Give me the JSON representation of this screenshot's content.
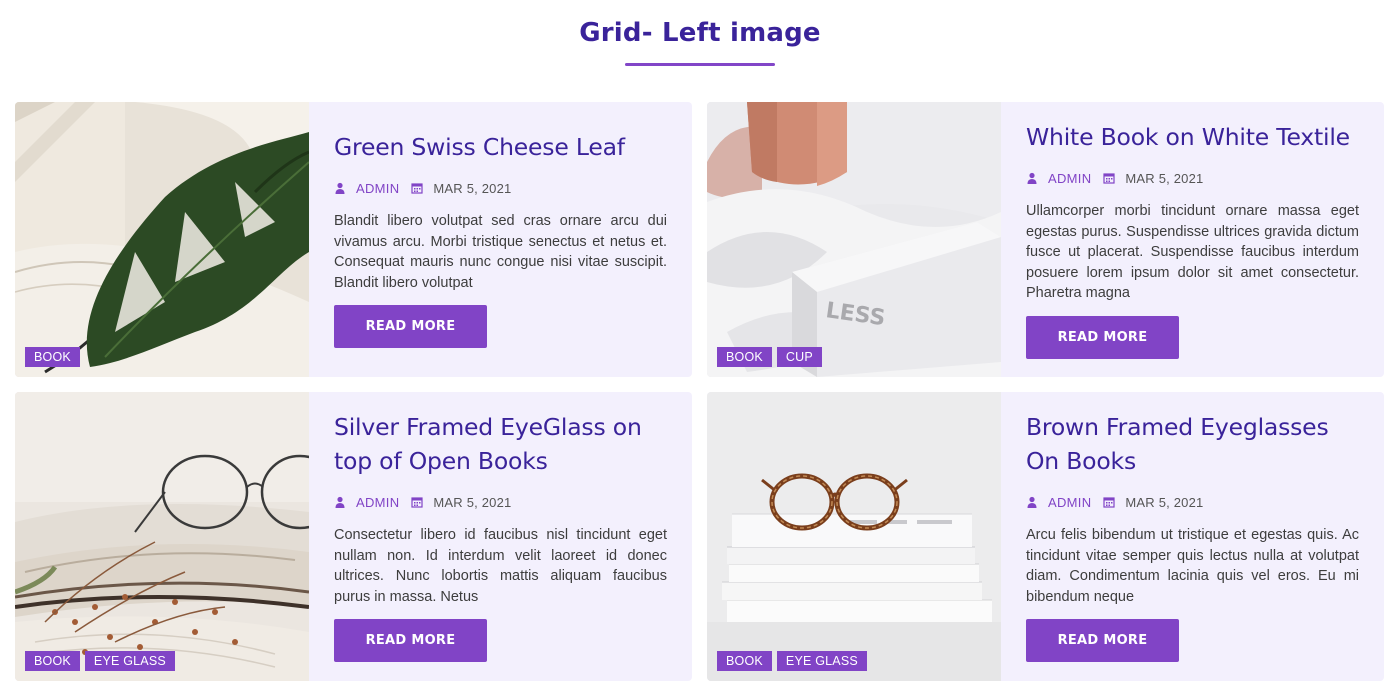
{
  "section": {
    "title": "Grid- Left image"
  },
  "colors": {
    "title": "#3a239a",
    "accent": "#8144c6",
    "card_bg": "#f3f0fd",
    "text": "#3d3d3d"
  },
  "icons": {
    "author": "user-icon",
    "date": "calendar-icon"
  },
  "cards": [
    {
      "image": "monstera-leaf-on-open-book",
      "tags": [
        "BOOK"
      ],
      "title": "Green Swiss Cheese Leaf",
      "author": "ADMIN",
      "date": "MAR 5, 2021",
      "excerpt": "Blandit libero volutpat sed cras ornare arcu dui vivamus arcu. Morbi tristique senectus et netus et. Consequat mauris nunc congue nisi vitae suscipit. Blandit libero volutpat",
      "button": "READ MORE"
    },
    {
      "image": "white-book-with-pink-mug",
      "tags": [
        "BOOK",
        "CUP"
      ],
      "title": "White Book on White Textile",
      "author": "ADMIN",
      "date": "MAR 5, 2021",
      "excerpt": "Ullamcorper morbi tincidunt ornare massa eget egestas purus. Suspendisse ultrices gravida dictum fusce ut placerat. Suspendisse faucibus interdum posuere lorem ipsum dolor sit amet consectetur. Pharetra magna",
      "button": "READ MORE"
    },
    {
      "image": "silver-eyeglasses-on-books",
      "tags": [
        "BOOK",
        "EYE GLASS"
      ],
      "title": "Silver Framed EyeGlass on top of Open Books",
      "author": "ADMIN",
      "date": "MAR 5, 2021",
      "excerpt": "Consectetur libero id faucibus nisl tincidunt eget nullam non. Id interdum velit laoreet id donec ultrices. Nunc lobortis mattis aliquam faucibus purus in massa. Netus",
      "button": "READ MORE"
    },
    {
      "image": "brown-eyeglasses-on-stacked-books",
      "tags": [
        "BOOK",
        "EYE GLASS"
      ],
      "title": "Brown Framed Eyeglasses On Books",
      "author": "ADMIN",
      "date": "MAR 5, 2021",
      "excerpt": "Arcu felis bibendum ut tristique et egestas quis. Ac tincidunt vitae semper quis lectus nulla at volutpat diam. Condimentum lacinia quis vel eros. Eu mi bibendum neque",
      "button": "READ MORE"
    }
  ]
}
